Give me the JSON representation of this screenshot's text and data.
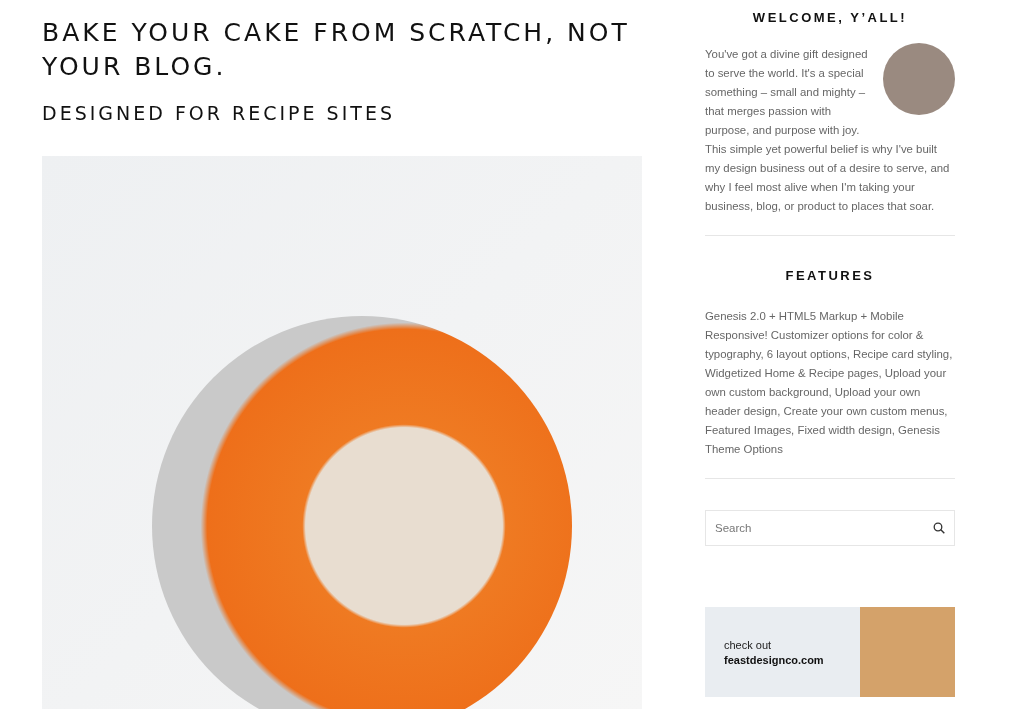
{
  "main": {
    "title": "BAKE YOUR CAKE FROM SCRATCH, NOT YOUR BLOG.",
    "subtitle": "DESIGNED FOR RECIPE SITES"
  },
  "sidebar": {
    "welcome": {
      "heading": "WELCOME, Y’ALL!",
      "text_beside_avatar": "You've got a divine gift designed to serve the world. It's a special something – small and mighty – that merges passion with purpose, and purpose with joy.",
      "text": "This simple yet powerful belief is why I've built my design business out of a desire to serve, and why I feel most alive when I'm taking your business, blog, or product to places that soar."
    },
    "features": {
      "heading": "FEATURES",
      "text": "Genesis 2.0 + HTML5 Markup + Mobile Responsive! Customizer options for color & typography, 6 layout options, Recipe card styling, Widgetized Home & Recipe pages, Upload your own custom background, Upload your own header design, Create your own custom menus, Featured Images, Fixed width design, Genesis Theme Options"
    },
    "search": {
      "placeholder": "Search"
    },
    "banner": {
      "line_1": "check out",
      "line_2": "feastdesignco.com"
    }
  }
}
